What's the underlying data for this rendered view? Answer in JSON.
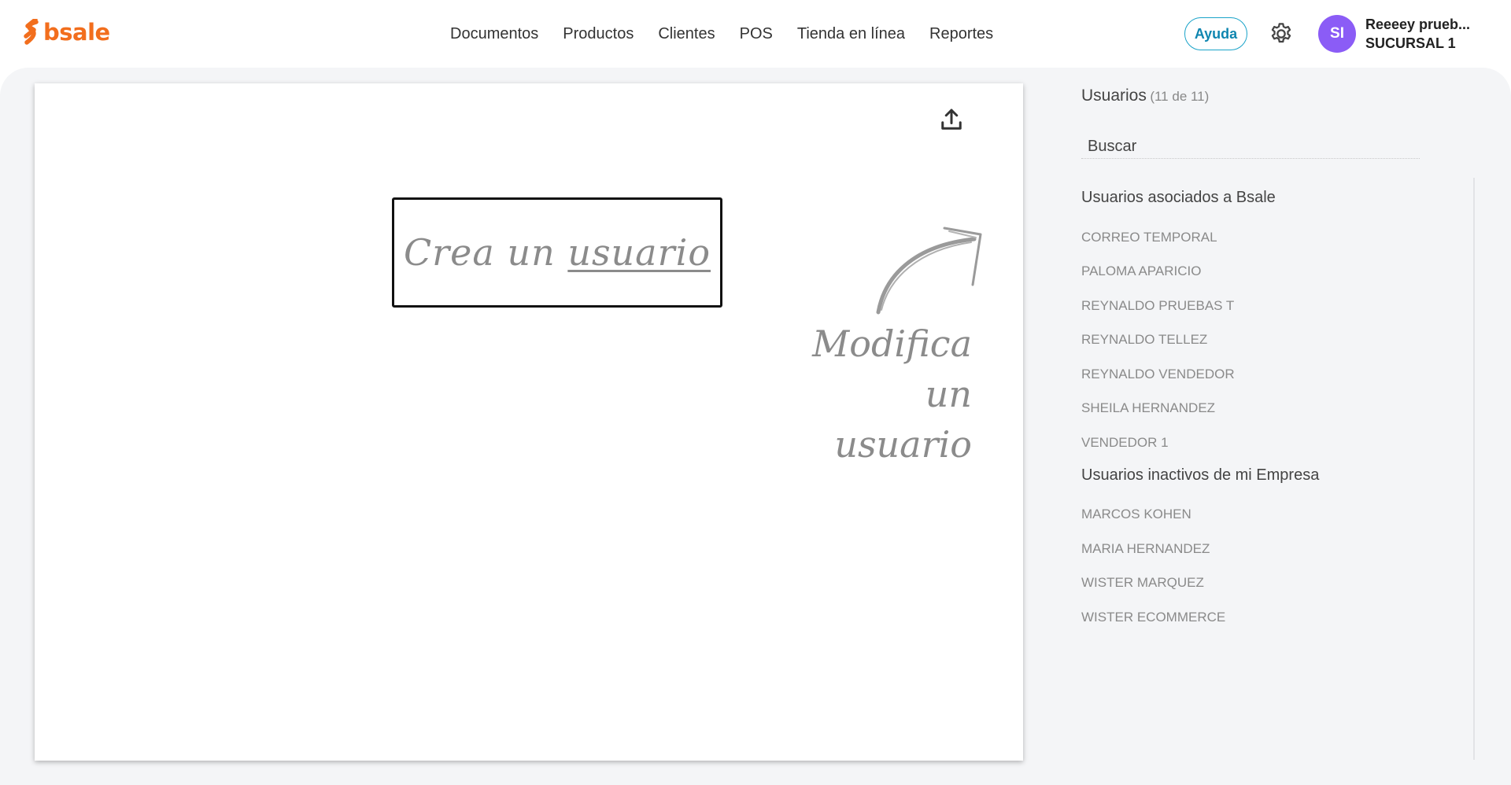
{
  "header": {
    "logo_text": "bsale",
    "nav": [
      "Documentos",
      "Productos",
      "Clientes",
      "POS",
      "Tienda en línea",
      "Reportes"
    ],
    "help_label": "Ayuda",
    "avatar_initials": "SI",
    "user_name": "Reeeey prueb...",
    "branch": "SUCURSAL 1"
  },
  "canvas": {
    "create_prefix": "Crea un",
    "create_link": "usuario",
    "modify_line1": "Modifica un",
    "modify_line2": "usuario"
  },
  "sidebar": {
    "title": "Usuarios",
    "count": "(11 de 11)",
    "search_placeholder": "Buscar",
    "groups": [
      {
        "title": "Usuarios asociados a Bsale",
        "users": [
          "CORREO TEMPORAL",
          "PALOMA APARICIO",
          "REYNALDO PRUEBAS T",
          "REYNALDO TELLEZ",
          "REYNALDO VENDEDOR",
          "SHEILA HERNANDEZ",
          "VENDEDOR 1"
        ]
      },
      {
        "title": "Usuarios inactivos de mi Empresa",
        "users": [
          "MARCOS KOHEN",
          "MARIA HERNANDEZ",
          "WISTER MARQUEZ",
          "WISTER ECOMMERCE"
        ]
      }
    ]
  },
  "colors": {
    "brand": "#f26e1d",
    "help_blue": "#1aa3c9",
    "avatar": "#8b5cf6"
  }
}
